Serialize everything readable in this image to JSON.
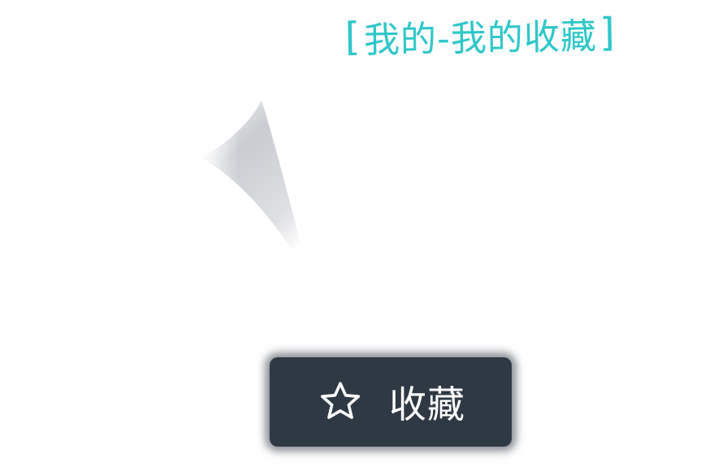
{
  "annotation": {
    "open_bracket": "[",
    "text": "我的-我的收藏",
    "close_bracket": "]",
    "color": "#2ec7c9"
  },
  "favorite_button": {
    "icon": "star-outline-icon",
    "label": "收藏",
    "background": "#2f3944",
    "text_color": "#ffffff"
  }
}
